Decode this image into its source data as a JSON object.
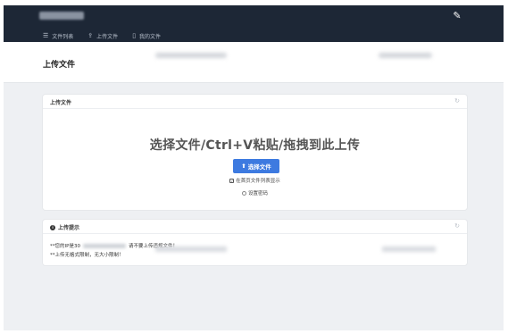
{
  "header": {
    "edit_icon": "pencil-icon",
    "nav": [
      {
        "label": "文件列表",
        "icon": "list-icon"
      },
      {
        "label": "上传文件",
        "icon": "upload-icon"
      },
      {
        "label": "我的文件",
        "icon": "file-icon"
      }
    ]
  },
  "page": {
    "title": "上传文件"
  },
  "upload_card": {
    "title": "上传文件",
    "drop_text": "选择文件/Ctrl+V粘贴/拖拽到此上传",
    "choose_button": "选择文件",
    "show_on_home_label": "在首页文件列表显示",
    "show_on_home_checked": true,
    "password_label": "设置密码",
    "password_selected": false
  },
  "tips_card": {
    "title": "上传提示",
    "line1_prefix": "**您的IP是30",
    "line1_suffix": "请不要上传违规文件！",
    "line2": "**上传无格式限制，无大小限制！"
  },
  "colors": {
    "header_bg": "#1d2736",
    "accent": "#3d7ae0",
    "page_bg": "#eef0f3"
  }
}
